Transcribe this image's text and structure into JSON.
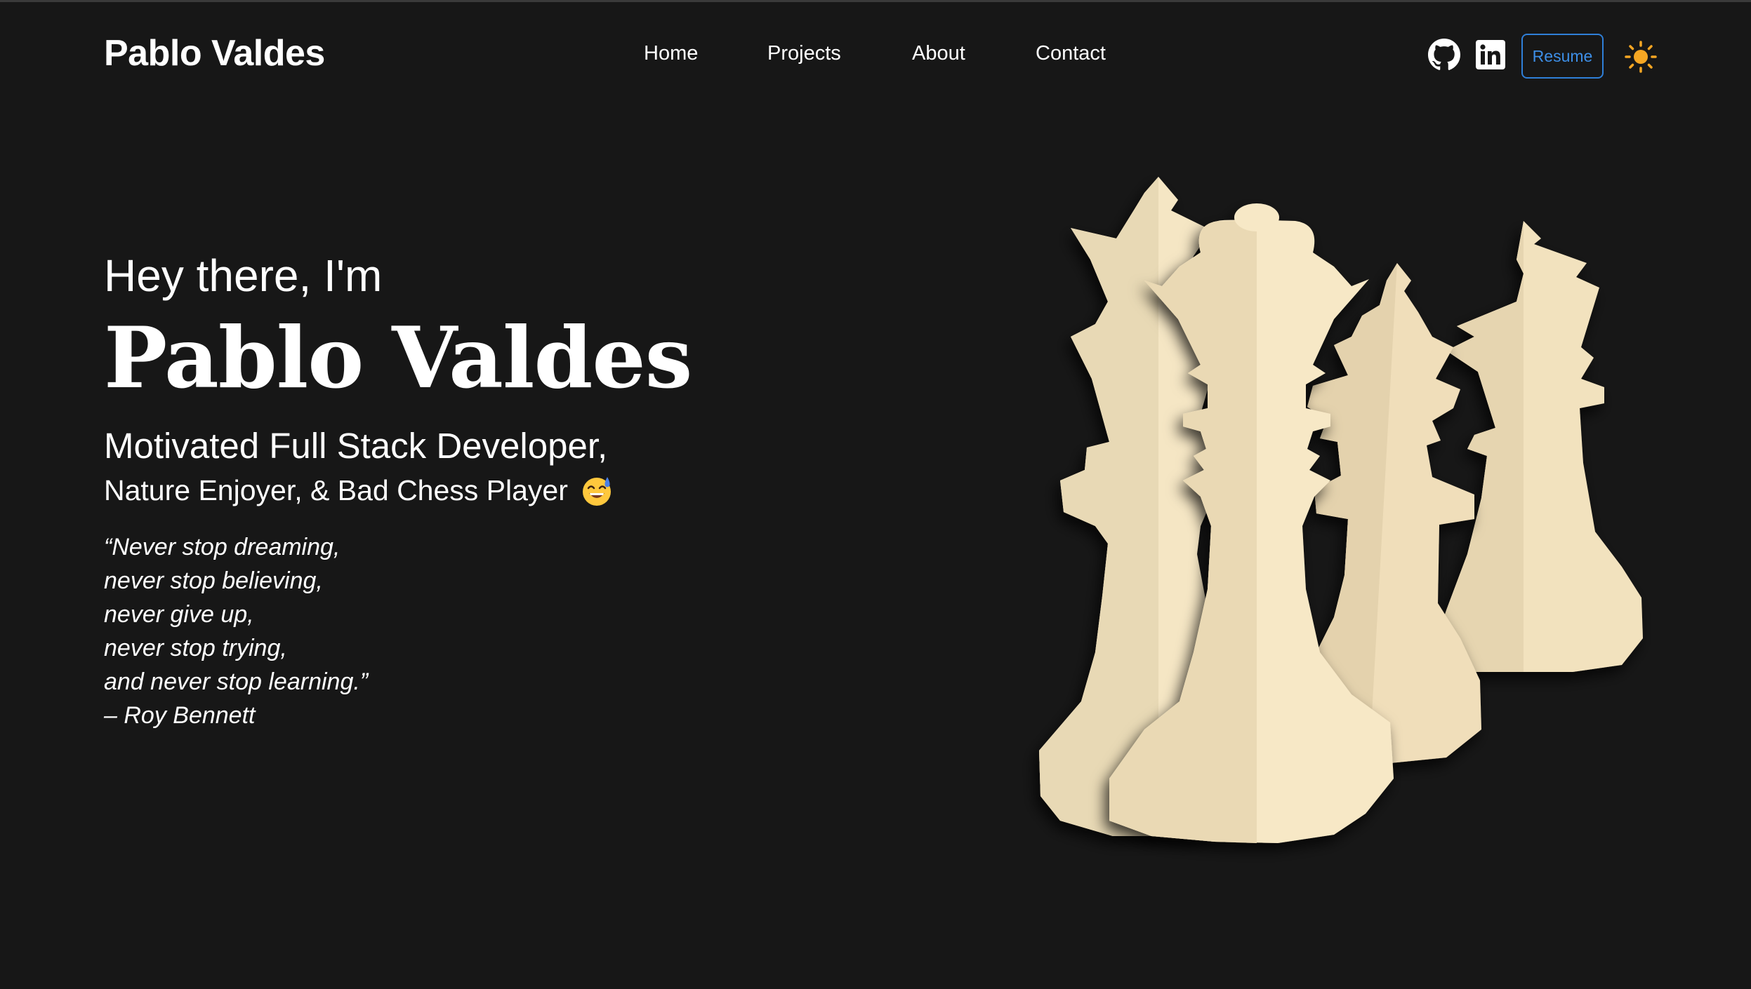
{
  "header": {
    "brand": "Pablo Valdes",
    "nav": [
      {
        "label": "Home"
      },
      {
        "label": "Projects"
      },
      {
        "label": "About"
      },
      {
        "label": "Contact"
      }
    ],
    "icons": {
      "github": "github-icon",
      "linkedin": "linkedin-icon",
      "theme": "sun-icon"
    },
    "resume_label": "Resume"
  },
  "hero": {
    "greeting": "Hey there, I'm",
    "name": "Pablo Valdes",
    "tagline_line1": "Motivated Full Stack Developer,",
    "tagline_line2": "Nature Enjoyer, & Bad Chess Player",
    "emoji": "grinning-sweat-emoji",
    "quote_lines": [
      "“Never stop dreaming,",
      "never stop believing,",
      "never give up,",
      "never stop trying,",
      "and never stop learning.”",
      "– Roy Bennett"
    ]
  },
  "colors": {
    "background": "#171717",
    "accent_blue": "#2f7fd8",
    "sun": "#f5a623",
    "chess_light": "#f5e6c4",
    "chess_shade": "#e8d9b5"
  }
}
